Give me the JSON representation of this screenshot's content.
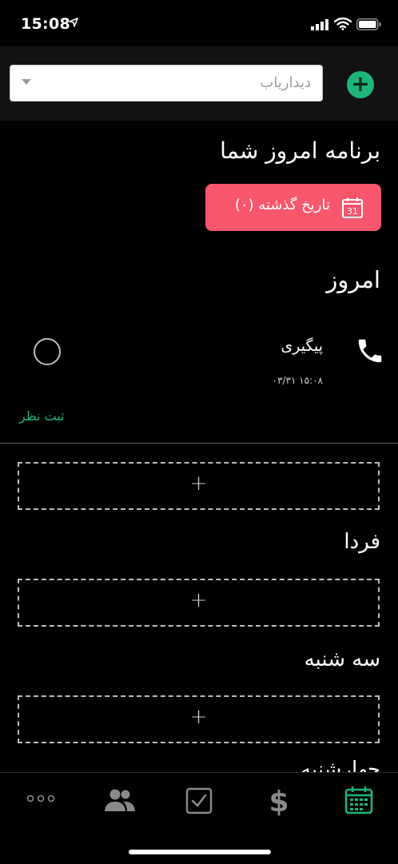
{
  "status": {
    "time": "15:08"
  },
  "search": {
    "placeholder": "دیداریاب"
  },
  "header": {
    "title": "برنامه امروز شما"
  },
  "history_button": {
    "label": "تاریخ گذشته (۰)",
    "icon_day": "31",
    "color": "#f7566c"
  },
  "today": {
    "heading": "امروز",
    "task": {
      "title": "پیگیری",
      "time": "۱۵:۰۸ ۰۳/۳۱",
      "icon": "phone-icon"
    },
    "comment_link": "ثبت نظر"
  },
  "days": [
    {
      "heading": "فردا"
    },
    {
      "heading": "سه شنبه"
    },
    {
      "heading": "چهارشنبه"
    }
  ],
  "add_slot_symbol": "+",
  "accent_color": "#1fb57a",
  "tabs": [
    {
      "name": "more",
      "icon": "more-icon"
    },
    {
      "name": "contacts",
      "icon": "people-icon"
    },
    {
      "name": "tasks",
      "icon": "checkbox-icon"
    },
    {
      "name": "finance",
      "icon": "dollar-icon"
    },
    {
      "name": "calendar",
      "icon": "calendar-icon",
      "active": true
    }
  ]
}
